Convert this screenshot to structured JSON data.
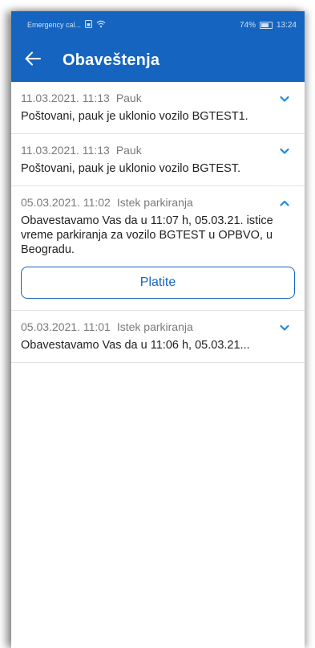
{
  "status_bar": {
    "carrier": "Emergency cal...",
    "battery": "74%",
    "time": "13:24"
  },
  "app_bar": {
    "title": "Obaveštenja",
    "back_icon": "arrow-left-icon"
  },
  "notifications": [
    {
      "date": "11.03.2021. 11:13",
      "type": "Pauk",
      "body": "Poštovani, pauk je uklonio vozilo BGTEST1.",
      "expanded": false
    },
    {
      "date": "11.03.2021. 11:13",
      "type": "Pauk",
      "body": "Poštovani, pauk je uklonio vozilo BGTEST.",
      "expanded": false
    },
    {
      "date": "05.03.2021. 11:02",
      "type": "Istek parkiranja",
      "body": "Obavestavamo Vas da u 11:07 h, 05.03.21. istice vreme parkiranja za vozilo BGTEST u OPBVO, u Beogradu.",
      "expanded": true,
      "action_label": "Platite"
    },
    {
      "date": "05.03.2021. 11:01",
      "type": "Istek parkiranja",
      "body": "Obavestavamo Vas da u 11:06 h, 05.03.21...",
      "expanded": false
    }
  ],
  "colors": {
    "primary": "#1565c0",
    "chevron": "#1e88e5",
    "meta_text": "#7a7a7a"
  }
}
